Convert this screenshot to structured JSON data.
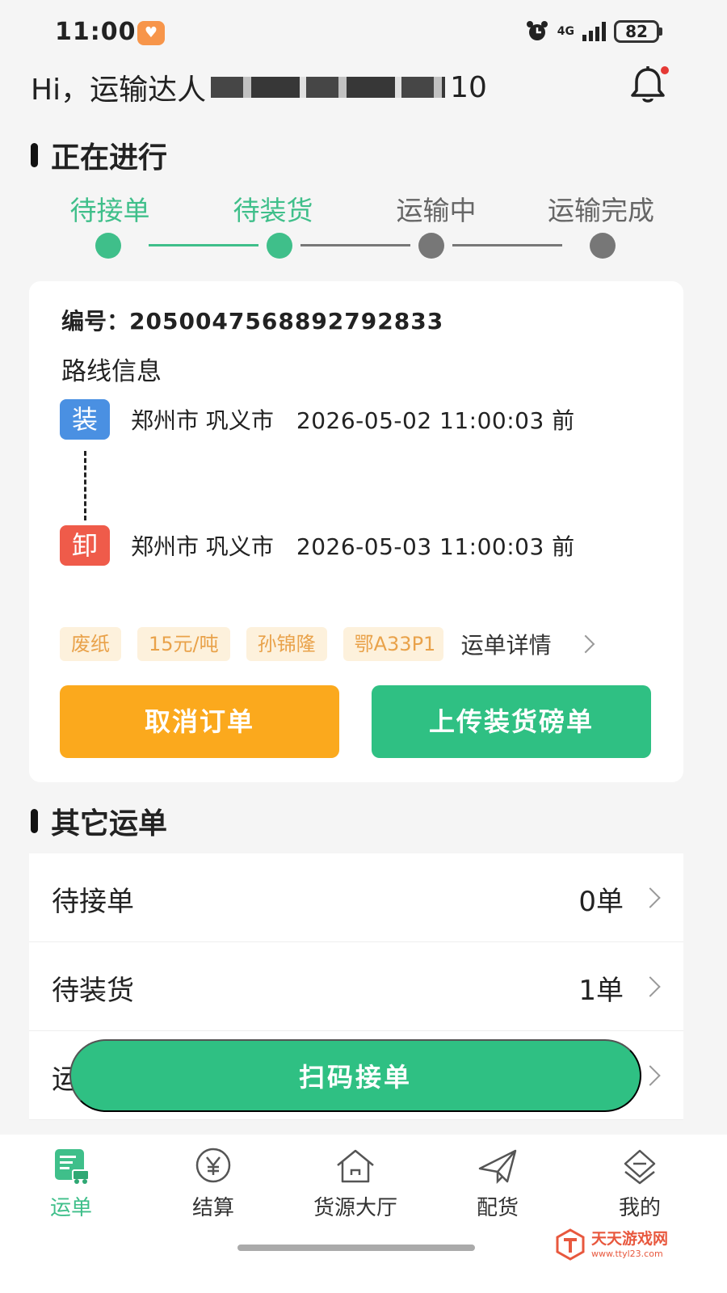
{
  "status_bar": {
    "time": "11:00",
    "network": "4G",
    "battery": "82"
  },
  "header": {
    "greeting_prefix": "Hi，运输达人",
    "greeting_suffix": "10"
  },
  "current_section": {
    "title": "正在进行"
  },
  "steps": [
    {
      "label": "待接单",
      "state": "done"
    },
    {
      "label": "待装货",
      "state": "done"
    },
    {
      "label": "运输中",
      "state": "pending"
    },
    {
      "label": "运输完成",
      "state": "pending"
    }
  ],
  "order": {
    "number_label": "编号：",
    "number": "2050047568892792833",
    "route_title": "路线信息",
    "load": {
      "tag": "装",
      "city": "郑州市 巩义市",
      "time": "2026-05-02 11:00:03 前"
    },
    "unload": {
      "tag": "卸",
      "city": "郑州市 巩义市",
      "time": "2026-05-03 11:00:03 前"
    },
    "tags": [
      "废纸",
      "15元/吨",
      "孙锦隆",
      "鄂A33P1"
    ],
    "detail_link": "运单详情",
    "cancel_button": "取消订单",
    "upload_button": "上传装货磅单"
  },
  "other_section": {
    "title": "其它运单",
    "items": [
      {
        "label": "待接单",
        "count": "0单"
      },
      {
        "label": "待装货",
        "count": "1单"
      },
      {
        "label": "运",
        "count": ""
      }
    ]
  },
  "scan_button": "扫码接单",
  "tabbar": {
    "items": [
      {
        "label": "运单",
        "icon": "waybill-icon",
        "active": true
      },
      {
        "label": "结算",
        "icon": "yen-icon",
        "active": false
      },
      {
        "label": "货源大厅",
        "icon": "home-icon",
        "active": false
      },
      {
        "label": "配货",
        "icon": "paper-plane-icon",
        "active": false
      },
      {
        "label": "我的",
        "icon": "user-icon",
        "active": false
      }
    ]
  },
  "watermark": {
    "title": "天天游戏网",
    "url": "www.ttyl23.com"
  },
  "colors": {
    "accent_green": "#2fc083",
    "step_active": "#3fbf8a",
    "step_inactive": "#777777",
    "orange": "#fba91d",
    "load_tag": "#4a90e2",
    "unload_tag": "#ef5b4a"
  }
}
